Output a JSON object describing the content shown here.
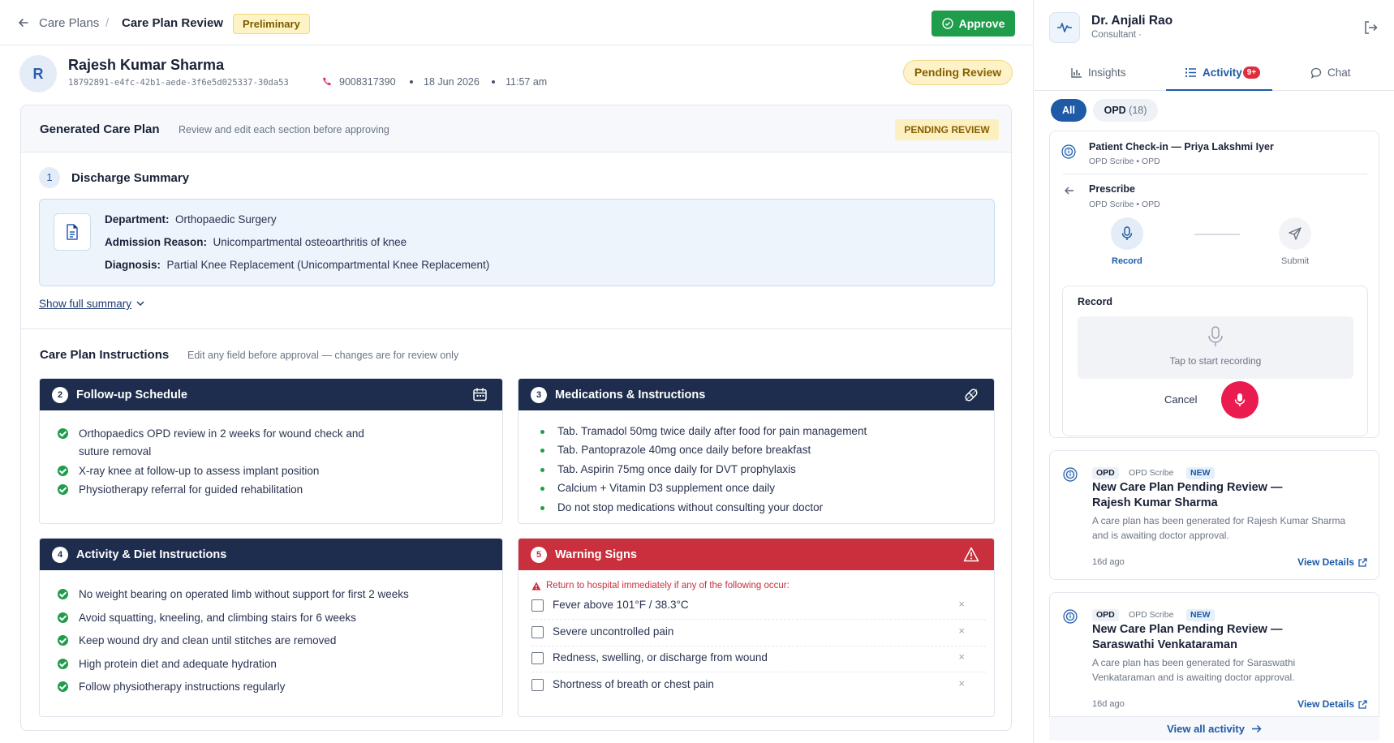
{
  "breadcrumb": {
    "parent": "Care Plans",
    "separator": "/",
    "current": "Care Plan Review"
  },
  "status_tag": "Preliminary",
  "approve_label": "Approve",
  "patient": {
    "initial": "R",
    "name": "Rajesh Kumar Sharma",
    "id": "18792891-e4fc-42b1-aede-3f6e5d025337-30da53",
    "phone": "9008317390",
    "date": "18 Jun 2026",
    "time": "11:57 am",
    "status": "Pending Review"
  },
  "generated": {
    "title": "Generated Care Plan",
    "subtitle": "Review and edit each section before approving",
    "badge": "PENDING REVIEW"
  },
  "discharge": {
    "num": "1",
    "title": "Discharge Summary",
    "department_label": "Department:",
    "department": "Orthopaedic Surgery",
    "reason_label": "Admission Reason:",
    "reason": "Unicompartmental osteoarthritis of knee",
    "diagnosis_label": "Diagnosis:",
    "diagnosis": "Partial Knee Replacement (Unicompartmental Knee Replacement)",
    "show_full": "Show full summary"
  },
  "instructions": {
    "title": "Care Plan Instructions",
    "subtitle": "Edit any field before approval — changes are for review only"
  },
  "followup": {
    "num": "2",
    "title": "Follow-up Schedule",
    "items": [
      "Orthopaedics OPD review in 2 weeks for wound check and",
      "suture removal",
      "X-ray knee at follow-up to assess implant position",
      "Physiotherapy referral for guided rehabilitation"
    ]
  },
  "medications": {
    "num": "3",
    "title": "Medications & Instructions",
    "items": [
      "Tab. Tramadol 50mg twice daily after food for pain management",
      "Tab. Pantoprazole 40mg once daily before breakfast",
      "Tab. Aspirin 75mg once daily for DVT prophylaxis",
      "Calcium + Vitamin D3 supplement once daily",
      "Do not stop medications without consulting your doctor"
    ]
  },
  "activity_diet": {
    "num": "4",
    "title": "Activity & Diet Instructions",
    "items": [
      "No weight bearing on operated limb without support for first 2 weeks",
      "Avoid squatting, kneeling, and climbing stairs for 6 weeks",
      "Keep wound dry and clean until stitches are removed",
      "High protein diet and adequate hydration",
      "Follow physiotherapy instructions regularly"
    ]
  },
  "warnings": {
    "num": "5",
    "title": "Warning Signs",
    "note": "Return to hospital immediately if any of the following occur:",
    "items": [
      "Fever above 101°F / 38.3°C",
      "Severe uncontrolled pain",
      "Redness, swelling, or discharge from wound",
      "Shortness of breath or chest pain"
    ],
    "remove": "×"
  },
  "doctor": {
    "name": "Dr. Anjali Rao",
    "role": "Consultant ·"
  },
  "tabs": {
    "insights": "Insights",
    "activity": "Activity",
    "activity_badge": "9+",
    "chat": "Chat"
  },
  "filters": {
    "all": "All",
    "opd": "OPD",
    "opd_count": "(18)"
  },
  "checkin": {
    "title": "Patient Check-in — Priya Lakshmi Iyer",
    "sub": "OPD Scribe • OPD",
    "prescribe_title": "Prescribe",
    "prescribe_sub": "OPD Scribe • OPD",
    "step_record": "Record",
    "step_submit": "Submit",
    "record_title": "Record",
    "tap_hint": "Tap to start recording",
    "cancel": "Cancel"
  },
  "notifications": [
    {
      "tag1": "OPD",
      "tag2": "OPD Scribe",
      "tag3": "NEW",
      "title_l1": "New Care Plan Pending Review —",
      "title_l2": "Rajesh Kumar Sharma",
      "desc": "A care plan has been generated for Rajesh Kumar Sharma and is awaiting doctor approval.",
      "ago": "16d ago",
      "action": "View Details"
    },
    {
      "tag1": "OPD",
      "tag2": "OPD Scribe",
      "tag3": "NEW",
      "title_l1": "New Care Plan Pending Review —",
      "title_l2": "Saraswathi Venkataraman",
      "desc": "A care plan has been generated for Saraswathi Venkataraman and is awaiting doctor approval.",
      "ago": "16d ago",
      "action": "View Details"
    }
  ],
  "view_all": "View all activity",
  "colors": {
    "navy": "#1e2d4d",
    "green": "#1f9d4b",
    "red": "#c92f3c",
    "accent": "#1f5aa6",
    "rose": "#ea1b4f"
  }
}
